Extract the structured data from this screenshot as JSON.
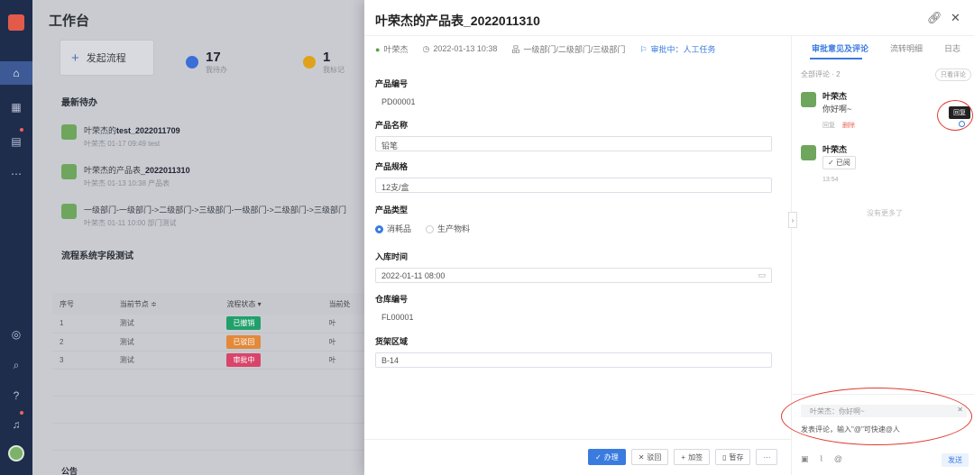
{
  "workspace": {
    "title": "工作台",
    "start_button": "发起流程",
    "stats": [
      {
        "value": "17",
        "label": "我待办",
        "color": "#3a6fd8"
      },
      {
        "value": "1",
        "label": "我标记",
        "color": "#e0a21a"
      }
    ],
    "section_pending": "最新待办",
    "tasks": [
      {
        "prefix": "叶荣杰的",
        "bold": "test_2022011709",
        "suffix": "",
        "meta": "叶荣杰   01-17 09:49      test"
      },
      {
        "prefix": "叶荣杰的产品表_",
        "bold": "2022011310",
        "suffix": "",
        "meta": "叶荣杰   01-13 10:38      产品表"
      },
      {
        "prefix": "一级部门-一级部门->二级部门->三级部门-一级部门->二级部门->三级部门",
        "bold": "",
        "suffix": "",
        "meta": "叶荣杰   01-11 10:00      部门测试"
      }
    ],
    "section_test": "流程系统字段测试",
    "table": {
      "headers": [
        "序号",
        "当前节点 ≑",
        "流程状态 ▾",
        "当前处"
      ],
      "rows": [
        {
          "no": "1",
          "node": "测试",
          "status": "已撤销",
          "color": "#22a06b",
          "who": "叶"
        },
        {
          "no": "2",
          "node": "测试",
          "status": "已驳回",
          "color": "#e2893a",
          "who": "叶"
        },
        {
          "no": "3",
          "node": "测试",
          "status": "审批中",
          "color": "#d9456a",
          "who": "叶"
        }
      ]
    },
    "bottom_label": "公告"
  },
  "drawer": {
    "title": "叶荣杰的产品表_2022011310",
    "meta": {
      "user": "叶荣杰",
      "time": "2022-01-13 10:38",
      "dept": "一级部门/二级部门/三级部门",
      "status_label": "审批中：",
      "status_value": "人工任务"
    },
    "fields": {
      "code_label": "产品编号",
      "code_value": "PD00001",
      "name_label": "产品名称",
      "name_value": "铅笔",
      "spec_label": "产品规格",
      "spec_value": "12支/盒",
      "type_label": "产品类型",
      "type_option1": "消耗品",
      "type_option2": "生产物料",
      "time_label": "入库时间",
      "time_value": "2022-01-11 08:00",
      "wh_label": "仓库编号",
      "wh_value": "FL00001",
      "shelf_label": "货架区域",
      "shelf_value": "B-14"
    },
    "buttons": {
      "handle": "办理",
      "reject": "驳回",
      "add_sign": "加签",
      "save": "暂存",
      "more": "···"
    }
  },
  "panel": {
    "tabs": [
      "审批意见及评论",
      "流转明细",
      "日志"
    ],
    "all_comments": "全部评论 · 2",
    "only_comments": "只看评论",
    "comments": [
      {
        "name": "叶荣杰",
        "text": "你好啊~",
        "reply": "回复",
        "delete": "删除"
      },
      {
        "name": "叶荣杰",
        "approved": "✓ 已阅",
        "time": "13:54"
      }
    ],
    "tooltip": "回复",
    "no_more": "没有更多了",
    "quote": "叶荣杰：你好啊~",
    "input_hint": "发表评论，输入\"@\"可快速@人",
    "send": "发送"
  }
}
